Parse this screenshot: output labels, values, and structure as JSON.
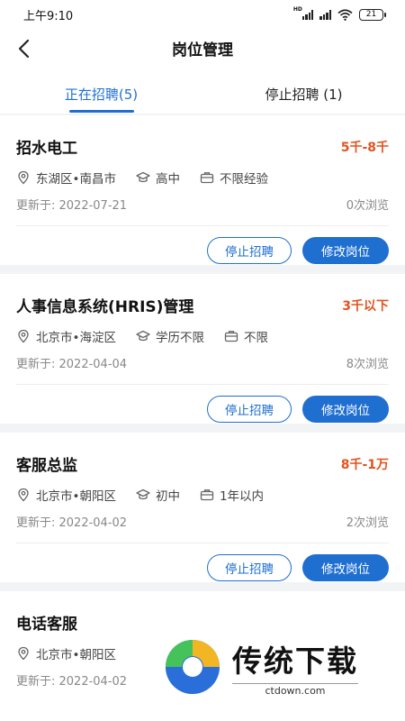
{
  "status_bar": {
    "time": "上午9:10",
    "signal_label": "HD",
    "battery": "21"
  },
  "header": {
    "title": "岗位管理"
  },
  "tabs": [
    {
      "label": "正在招聘(5)",
      "active": true
    },
    {
      "label": "停止招聘 (1)",
      "active": false
    }
  ],
  "jobs": [
    {
      "title": "招水电工",
      "salary": "5千-8千",
      "location": "东湖区•南昌市",
      "education": "高中",
      "experience": "不限经验",
      "updated": "更新于: 2022-07-21",
      "views": "0次浏览",
      "stop_label": "停止招聘",
      "edit_label": "修改岗位"
    },
    {
      "title": "人事信息系统(HRIS)管理",
      "salary": "3千以下",
      "location": "北京市•海淀区",
      "education": "学历不限",
      "experience": "不限",
      "updated": "更新于: 2022-04-04",
      "views": "8次浏览",
      "stop_label": "停止招聘",
      "edit_label": "修改岗位"
    },
    {
      "title": "客服总监",
      "salary": "8千-1万",
      "location": "北京市•朝阳区",
      "education": "初中",
      "experience": "1年以内",
      "updated": "更新于: 2022-04-02",
      "views": "2次浏览",
      "stop_label": "停止招聘",
      "edit_label": "修改岗位"
    },
    {
      "title": "电话客服",
      "salary": "",
      "location": "北京市•朝阳区",
      "education": "",
      "experience": "",
      "updated": "更新于: 2022-04-02",
      "views": "",
      "stop_label": "",
      "edit_label": ""
    }
  ],
  "watermark": {
    "name": "传统下载",
    "domain": "ctdown.com"
  },
  "colors": {
    "accent": "#1f6fd1",
    "salary": "#e2531f",
    "background": "#f2f3f5"
  }
}
